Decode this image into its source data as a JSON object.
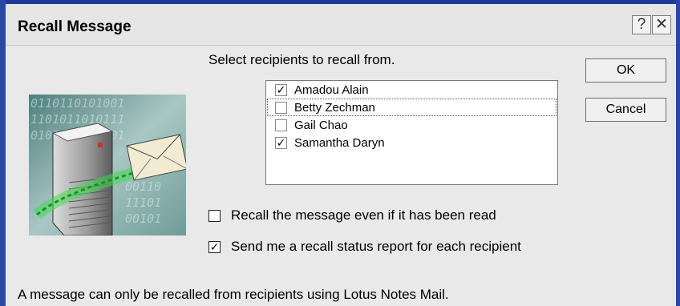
{
  "window": {
    "title": "Recall Message",
    "help_label": "?",
    "close_label": "✕"
  },
  "prompt": "Select recipients to recall from.",
  "recipients": [
    {
      "name": "Amadou Alain",
      "checked": true
    },
    {
      "name": "Betty Zechman",
      "checked": false
    },
    {
      "name": "Gail Chao",
      "checked": false
    },
    {
      "name": "Samantha Daryn",
      "checked": true
    }
  ],
  "buttons": {
    "ok": "OK",
    "cancel": "Cancel"
  },
  "options": {
    "recall_even_if_read": {
      "label": "Recall the message even if it has been read",
      "checked": false
    },
    "send_status_report": {
      "label": "Send me a recall status report for each recipient",
      "checked": true
    }
  },
  "footer_note": "A message can only be recalled from recipients using Lotus Notes Mail.",
  "check_glyph": "✓",
  "colors": {
    "window_frame": "#1f3a93",
    "dialog_bg": "#e9e9e9",
    "illustration_glow": "#3ddc4a"
  },
  "icons": [
    "recall-server-envelope-illustration"
  ]
}
